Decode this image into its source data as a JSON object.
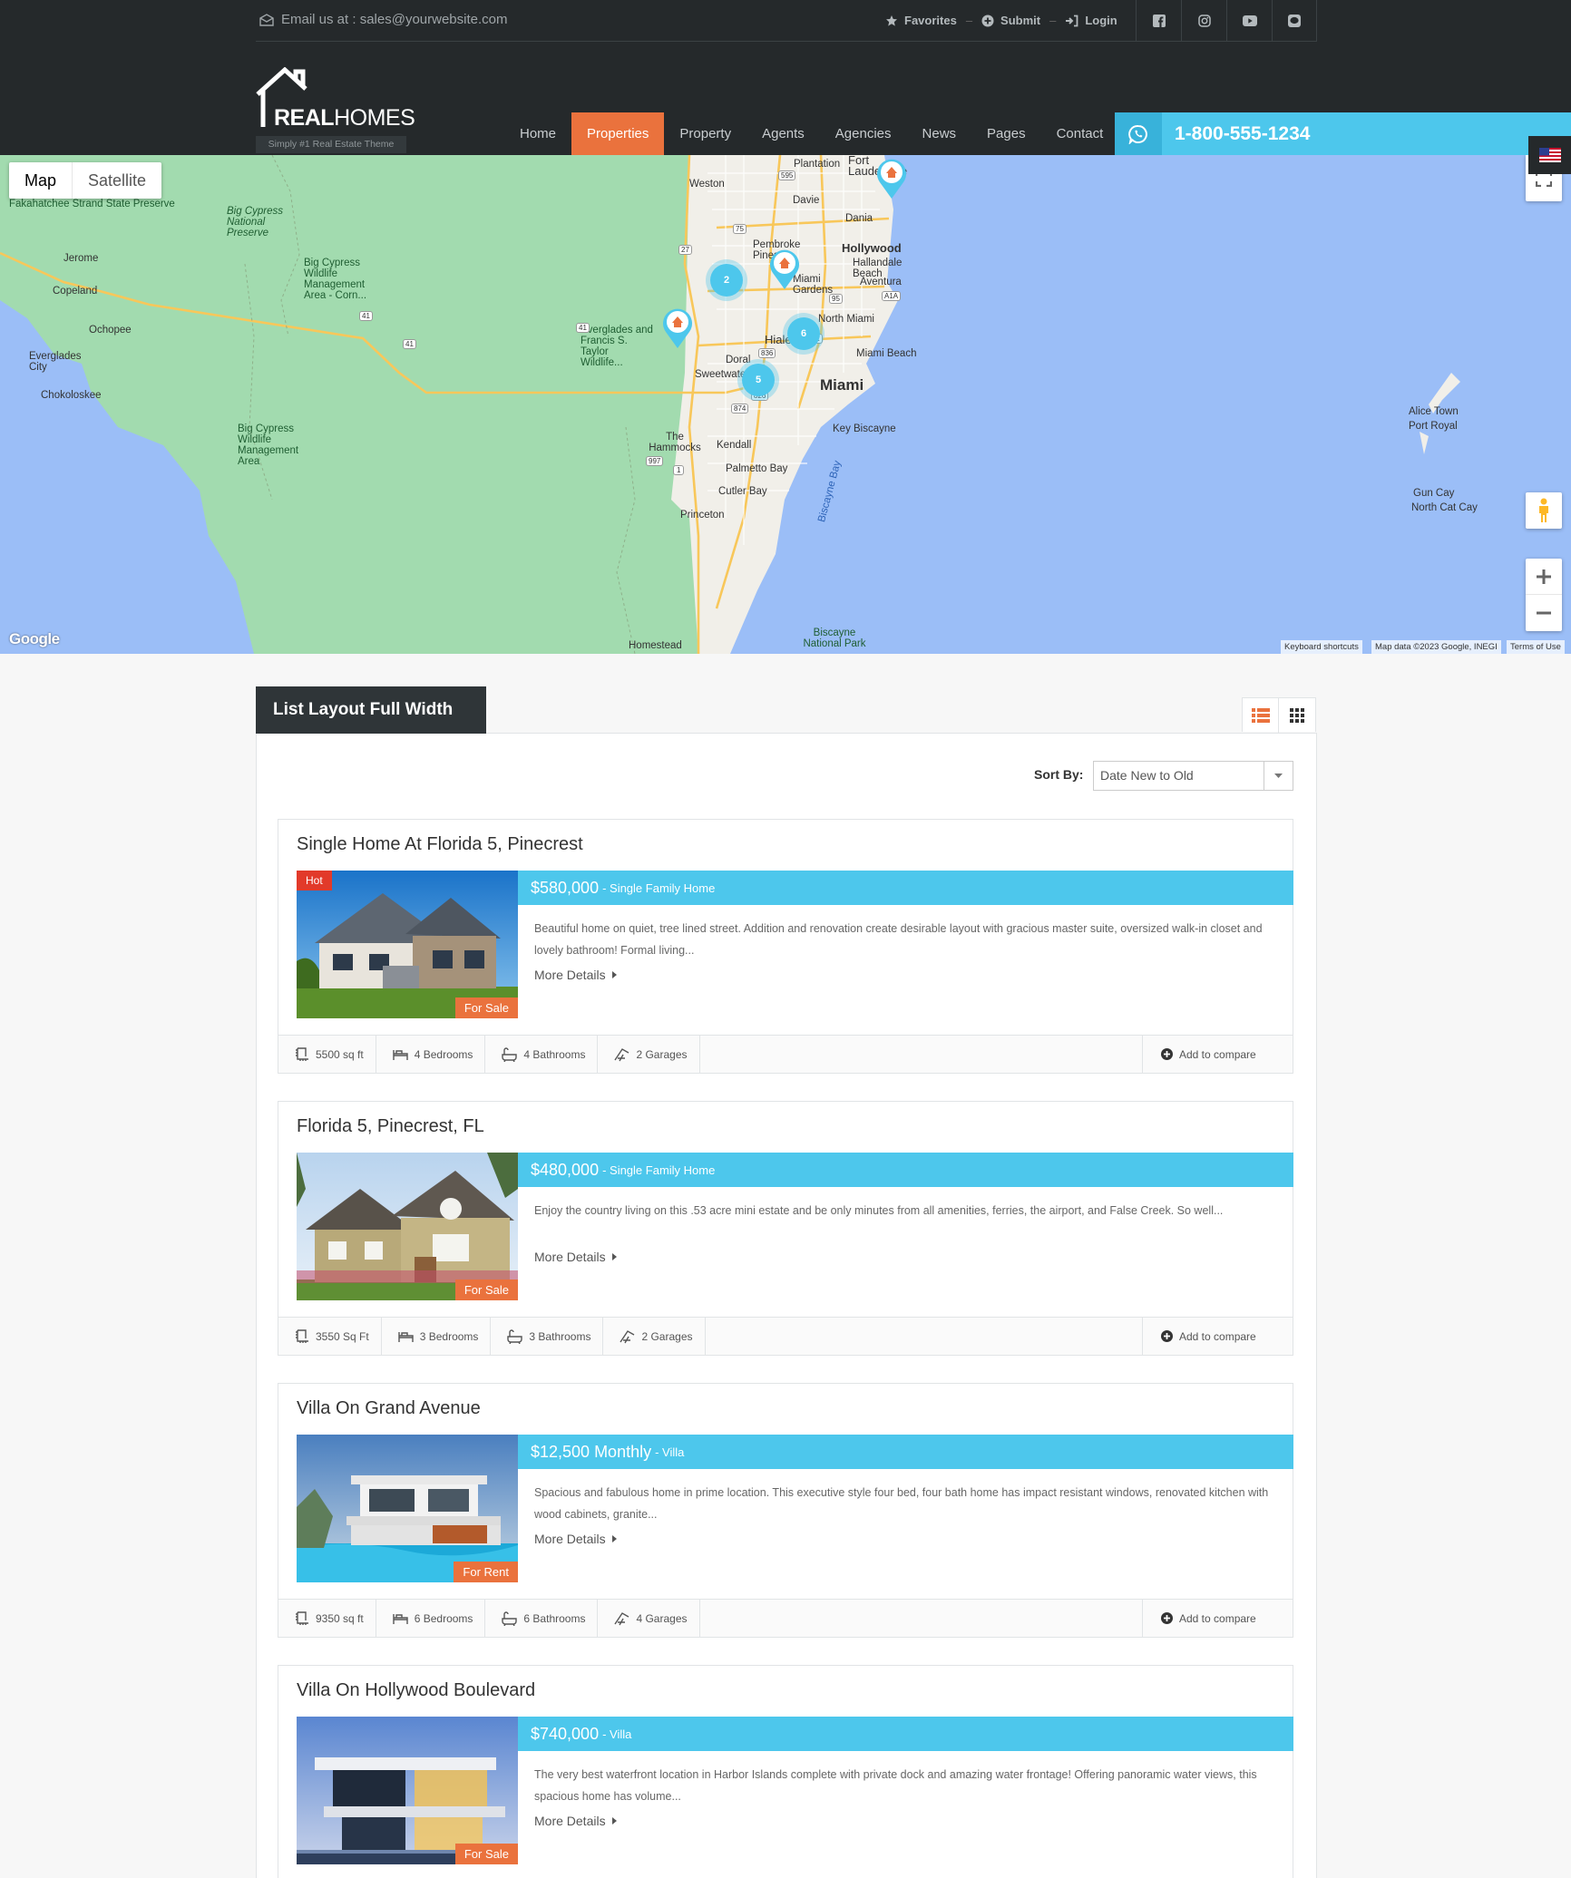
{
  "header": {
    "email": "Email us at : sales@yourwebsite.com",
    "links": [
      "Favorites",
      "Submit",
      "Login"
    ],
    "socials": [
      "facebook-icon",
      "instagram-icon",
      "youtube-icon",
      "line-icon"
    ],
    "logo": {
      "bold": "REAL",
      "light": "HOMES",
      "tagline": "Simply #1 Real Estate Theme"
    },
    "nav": [
      "Home",
      "Properties",
      "Property",
      "Agents",
      "Agencies",
      "News",
      "Pages",
      "Contact"
    ],
    "active_nav": "Properties",
    "phone": "1-800-555-1234"
  },
  "map": {
    "types": [
      "Map",
      "Satellite"
    ],
    "selected_type": "Map",
    "labels": [
      "Fakahatchee Strand State Preserve",
      "Jerome",
      "Copeland",
      "Ochopee",
      "Everglades City",
      "Chokoloskee",
      "Big Cypress National Preserve",
      "Big Cypress Wildlife Management Area - Corn...",
      "Big Cypress Wildlife Management Area",
      "Everglades and Francis S. Taylor Wildlife...",
      "Plantation",
      "Fort Lauderdale",
      "Weston",
      "Davie",
      "Dania",
      "Hollywood",
      "Pembroke Pines",
      "Hallandale Beach",
      "Aventura",
      "Miami Gardens",
      "North Miami",
      "Hialeah",
      "Doral",
      "Miami Beach",
      "Sweetwater",
      "Miami",
      "Key Biscayne",
      "The Hammocks",
      "Kendall",
      "Palmetto Bay",
      "Cutler Bay",
      "Princeton",
      "Homestead",
      "Biscayne Bay",
      "Biscayne National Park",
      "Alice Town",
      "Port Royal",
      "Gun Cay",
      "North Cat Cay"
    ],
    "clusters": [
      "2",
      "6",
      "5"
    ],
    "road_shields": [
      "595",
      "75",
      "27",
      "41",
      "41",
      "41",
      "95",
      "A1A",
      "112",
      "836",
      "826",
      "874",
      "997",
      "1"
    ],
    "attribution": [
      "Keyboard shortcuts",
      "Map data ©2023 Google, INEGI",
      "Terms of Use"
    ],
    "google": "Google"
  },
  "listing": {
    "title": "List Layout Full Width",
    "sort_label": "Sort By:",
    "sort_value": "Date New to Old",
    "more_label": "More Details",
    "compare_label": "Add to compare",
    "properties": [
      {
        "title": "Single Home At Florida 5, Pinecrest",
        "hot": "Hot",
        "status": "For Sale",
        "price": "$580,000",
        "type": "- Single Family Home",
        "desc": "Beautiful home on quiet, tree lined street. Addition and renovation create desirable layout with gracious master suite, oversized walk-in closet and lovely bathroom! Formal living...",
        "area": "5500 sq ft",
        "beds": "4 Bedrooms",
        "baths": "4 Bathrooms",
        "garages": "2 Garages"
      },
      {
        "title": "Florida 5, Pinecrest, FL",
        "status": "For Sale",
        "price": "$480,000",
        "type": "- Single Family Home",
        "desc": "Enjoy the country living on this .53 acre mini estate and be only minutes from all amenities, ferries, the airport, and False Creek. So well...",
        "area": "3550 Sq Ft",
        "beds": "3 Bedrooms",
        "baths": "3 Bathrooms",
        "garages": "2 Garages"
      },
      {
        "title": "Villa On Grand Avenue",
        "status": "For Rent",
        "price": "$12,500 Monthly",
        "type": "- Villa",
        "desc": "Spacious and fabulous home in prime location. This executive style four bed, four bath home has impact resistant windows, renovated kitchen with wood cabinets, granite...",
        "area": "9350 sq ft",
        "beds": "6 Bedrooms",
        "baths": "6 Bathrooms",
        "garages": "4 Garages"
      },
      {
        "title": "Villa On Hollywood Boulevard",
        "status": "For Sale",
        "price": "$740,000",
        "type": "- Villa",
        "desc": "The very best waterfront location in Harbor Islands complete with private dock and amazing water frontage! Offering panoramic water views, this spacious home has volume..."
      }
    ]
  },
  "colors": {
    "accent_orange": "#ea723d",
    "accent_blue": "#4dc7ec",
    "header_dark": "#25292b",
    "hot_red": "#e23a2a"
  }
}
